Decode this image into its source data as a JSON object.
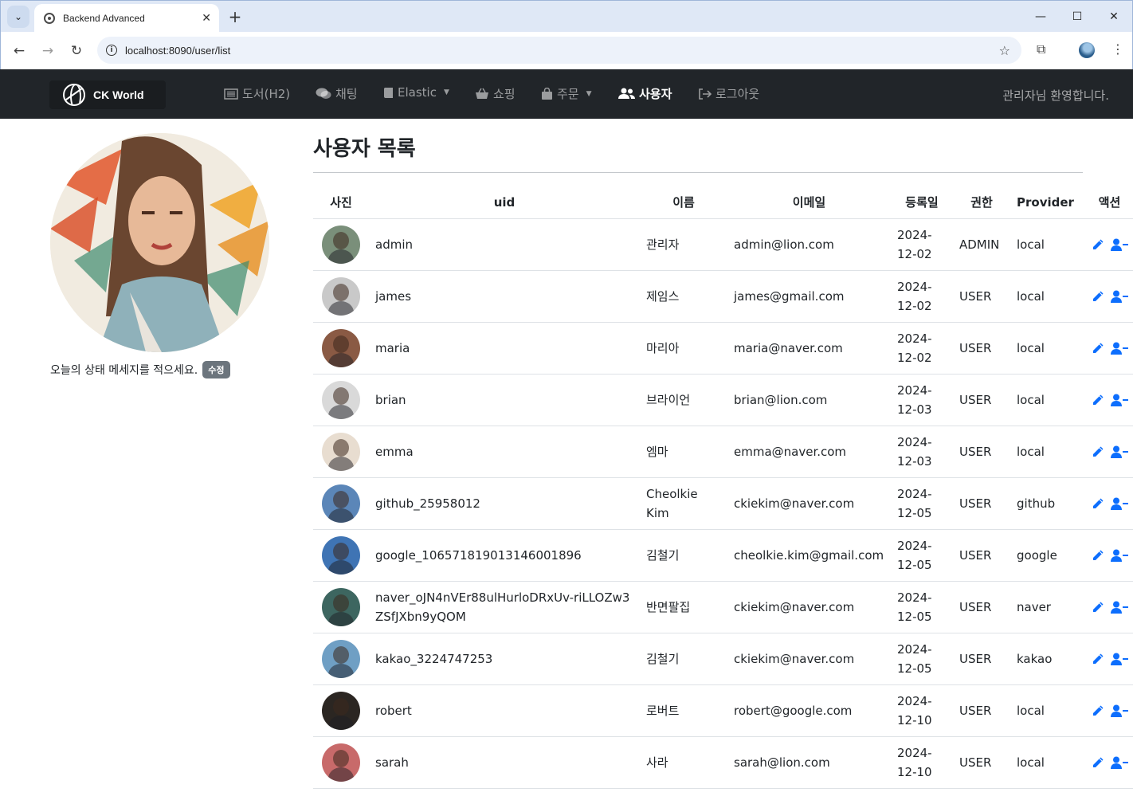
{
  "browser": {
    "tab_title": "Backend Advanced",
    "url": "localhost:8090/user/list"
  },
  "navbar": {
    "brand": "CK World",
    "links": [
      {
        "label": "도서(H2)",
        "icon": "list-icon",
        "dropdown": false,
        "active": false
      },
      {
        "label": "채팅",
        "icon": "chat-icon",
        "dropdown": false,
        "active": false
      },
      {
        "label": "Elastic",
        "icon": "book-icon",
        "dropdown": true,
        "active": false
      },
      {
        "label": "쇼핑",
        "icon": "basket-icon",
        "dropdown": false,
        "active": false
      },
      {
        "label": "주문",
        "icon": "bag-icon",
        "dropdown": true,
        "active": false
      },
      {
        "label": "사용자",
        "icon": "users-icon",
        "dropdown": false,
        "active": true
      },
      {
        "label": "로그아웃",
        "icon": "logout-icon",
        "dropdown": false,
        "active": false
      }
    ],
    "welcome": "관리자님 환영합니다."
  },
  "sidebar": {
    "status_message": "오늘의 상태 메세지를 적으세요.",
    "edit_badge": "수정"
  },
  "main": {
    "title": "사용자 목록",
    "columns": [
      "사진",
      "uid",
      "이름",
      "이메일",
      "등록일",
      "권한",
      "Provider",
      "액션"
    ],
    "rows": [
      {
        "uid": "admin",
        "name": "관리자",
        "email": "admin@lion.com",
        "date1": "2024-",
        "date2": "12-02",
        "role": "ADMIN",
        "provider": "local",
        "color": "#7a8f7a"
      },
      {
        "uid": "james",
        "name": "제임스",
        "email": "james@gmail.com",
        "date1": "2024-",
        "date2": "12-02",
        "role": "USER",
        "provider": "local",
        "color": "#c9c9c9"
      },
      {
        "uid": "maria",
        "name": "마리아",
        "email": "maria@naver.com",
        "date1": "2024-",
        "date2": "12-02",
        "role": "USER",
        "provider": "local",
        "color": "#8a5a44"
      },
      {
        "uid": "brian",
        "name": "브라이언",
        "email": "brian@lion.com",
        "date1": "2024-",
        "date2": "12-03",
        "role": "USER",
        "provider": "local",
        "color": "#d9d9d9"
      },
      {
        "uid": "emma",
        "name": "엠마",
        "email": "emma@naver.com",
        "date1": "2024-",
        "date2": "12-03",
        "role": "USER",
        "provider": "local",
        "color": "#e8ddd0"
      },
      {
        "uid": "github_25958012",
        "name": "Cheolkie Kim",
        "email": "ckiekim@naver.com",
        "date1": "2024-",
        "date2": "12-05",
        "role": "USER",
        "provider": "github",
        "color": "#5b86b8"
      },
      {
        "uid": "google_106571819013146001896",
        "name": "김철기",
        "email": "cheolkie.kim@gmail.com",
        "date1": "2024-",
        "date2": "12-05",
        "role": "USER",
        "provider": "google",
        "color": "#3f74b4"
      },
      {
        "uid": "naver_oJN4nVEr88ulHurloDRxUv-riLLOZw3ZSfJXbn9yQOM",
        "name": "반면팔집",
        "email": "ckiekim@naver.com",
        "date1": "2024-",
        "date2": "12-05",
        "role": "USER",
        "provider": "naver",
        "color": "#3d6660"
      },
      {
        "uid": "kakao_3224747253",
        "name": "김철기",
        "email": "ckiekim@naver.com",
        "date1": "2024-",
        "date2": "12-05",
        "role": "USER",
        "provider": "kakao",
        "color": "#6f9fc4"
      },
      {
        "uid": "robert",
        "name": "로버트",
        "email": "robert@google.com",
        "date1": "2024-",
        "date2": "12-10",
        "role": "USER",
        "provider": "local",
        "color": "#2b2622"
      },
      {
        "uid": "sarah",
        "name": "사라",
        "email": "sarah@lion.com",
        "date1": "2024-",
        "date2": "12-10",
        "role": "USER",
        "provider": "local",
        "color": "#c86a6a"
      }
    ]
  },
  "colors": {
    "navbar_bg": "#212529",
    "action_blue": "#0d6efd",
    "badge_gray": "#6c757d"
  }
}
